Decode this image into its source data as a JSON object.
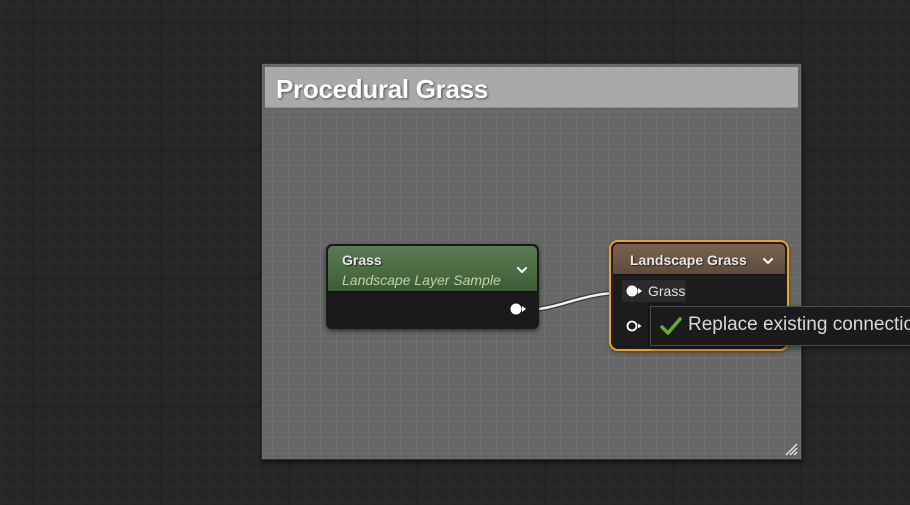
{
  "comment": {
    "title": "Procedural Grass"
  },
  "nodes": {
    "grass_sample": {
      "title": "Grass",
      "subtitle": "Landscape Layer Sample",
      "header_color": "#4c6c45"
    },
    "landscape_grass": {
      "title": "Landscape Grass",
      "header_color": "#5e4b3d",
      "selection_color": "#f0a020",
      "inputs": [
        {
          "label": "Grass",
          "connected": true
        },
        {
          "label": "",
          "connected": false
        }
      ]
    }
  },
  "tooltip": {
    "icon": "check-icon",
    "text": "Replace existing connection"
  },
  "icons": {
    "expand": "chevron-down-icon",
    "resize": "resize-handle-icon"
  }
}
